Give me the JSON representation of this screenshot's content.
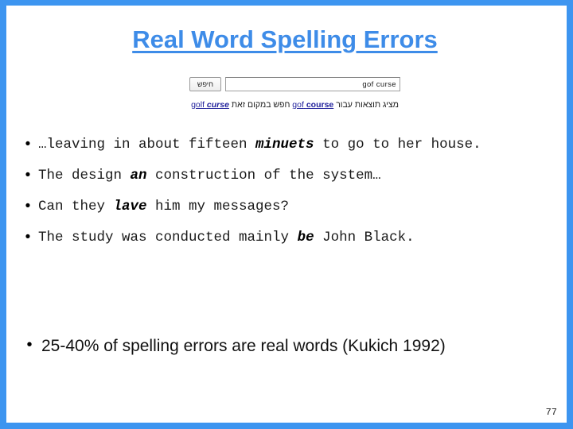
{
  "slide": {
    "title": "Real Word Spelling Errors",
    "page_number": "77",
    "frame_color": "#3d95f0",
    "title_color": "#3e8ce8",
    "link_color": "#22229c"
  },
  "google_screenshot": {
    "search_button_label": "חיפש",
    "search_field_value": "gof curse",
    "suggestion": {
      "prefix_text": "מציג תוצאות עבור",
      "corrected_query_plain": "gof",
      "corrected_query_bold": "course",
      "middle_text": "חפש במקום זאת",
      "original_query_plain": "golf",
      "original_query_bold_italic": "curse"
    }
  },
  "bullets": [
    {
      "pre": "…leaving in about fifteen ",
      "highlight": "minuets",
      "post": " to go to her house."
    },
    {
      "pre": "The design ",
      "highlight": "an",
      "post": " construction of the system…"
    },
    {
      "pre": "Can they ",
      "highlight": "lave",
      "post": " him my messages?"
    },
    {
      "pre": "The study was conducted mainly ",
      "highlight": "be",
      "post": " John Black."
    }
  ],
  "summary_bullet": {
    "text": "25-40% of spelling errors are real words  (Kukich 1992)"
  },
  "icons": {
    "bullet_marker": "•"
  }
}
